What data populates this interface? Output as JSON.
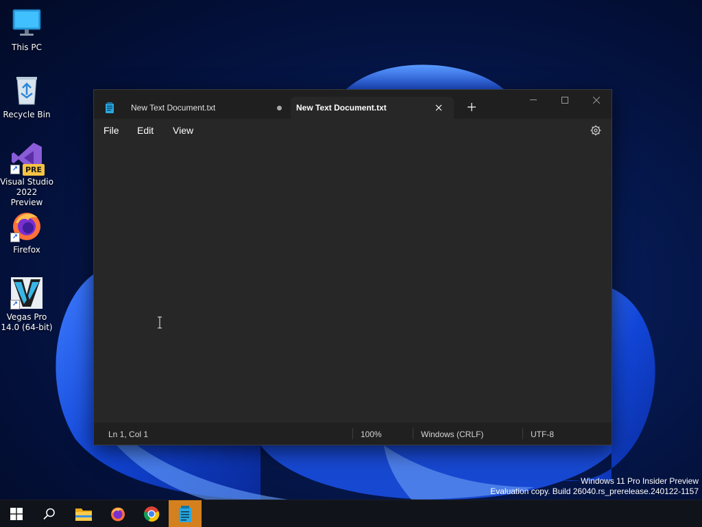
{
  "desktop": {
    "icons": [
      {
        "label": "This PC",
        "icon": "monitor-icon"
      },
      {
        "label": "Recycle Bin",
        "icon": "recycle-bin-icon"
      },
      {
        "label": "Visual Studio\n2022 Preview",
        "label_line1": "Visual Studio",
        "label_line2": "2022 Preview",
        "badge": "PRE",
        "icon": "visual-studio-icon"
      },
      {
        "label": "Firefox",
        "icon": "firefox-icon"
      },
      {
        "label_line1": "Vegas Pro",
        "label_line2": "14.0 (64-bit)",
        "icon": "vegas-pro-icon"
      }
    ]
  },
  "notepad": {
    "tabs": [
      {
        "label": "New Text Document.txt",
        "active": false,
        "unsaved": true
      },
      {
        "label": "New Text Document.txt",
        "active": true,
        "unsaved": false
      }
    ],
    "menu": {
      "file": "File",
      "edit": "Edit",
      "view": "View"
    },
    "status": {
      "position": "Ln 1, Col 1",
      "zoom": "100%",
      "line_ending": "Windows (CRLF)",
      "encoding": "UTF-8"
    }
  },
  "watermark": {
    "line1": "Windows 11 Pro Insider Preview",
    "line2": "Evaluation copy. Build 26040.rs_prerelease.240122-1157"
  },
  "taskbar": {
    "items": [
      "start-icon",
      "search-icon",
      "file-explorer-icon",
      "firefox-icon",
      "chrome-icon",
      "notepad-icon"
    ],
    "active": "notepad-icon"
  },
  "colors": {
    "accent": "#d5801f",
    "window_bg": "#272727",
    "titlebar_bg": "#1f1f1f"
  }
}
